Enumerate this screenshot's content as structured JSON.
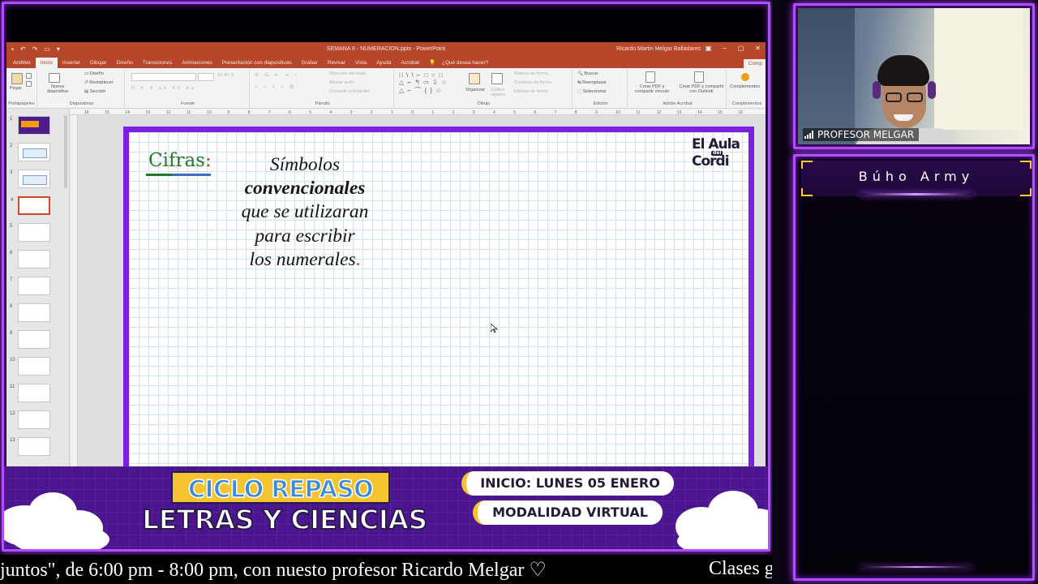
{
  "powerpoint": {
    "document_title": "SEMANA 8 - NUMERACION.pptx - PowerPoint",
    "user_name": "Ricardo Martin Melgar Balladares",
    "tabs": [
      "Archivo",
      "Inicio",
      "Insertar",
      "Dibujar",
      "Diseño",
      "Transiciones",
      "Animaciones",
      "Presentación con diapositivas",
      "Grabar",
      "Revisar",
      "Vista",
      "Ayuda",
      "Acrobat"
    ],
    "active_tab": "Inicio",
    "tell_me": "¿Qué desea hacer?",
    "share_label": "Comp",
    "ribbon": {
      "portapapeles": "Portapapeles",
      "pegar": "Pegar",
      "diapositivas": "Diapositivas",
      "nueva_diapositiva": "Nueva diapositiva",
      "diseno": "Diseño",
      "restablecer": "Restablecer",
      "seccion": "Sección",
      "fuente": "Fuente",
      "parrafo": "Párrafo",
      "direccion_texto": "Dirección del texto",
      "alinear_texto": "Alinear texto",
      "convertir_smartart": "Convertir a SmartArt",
      "dibujo": "Dibujo",
      "organizar": "Organizar",
      "estilos_rapidos": "Estilos rápidos",
      "relleno_forma": "Relleno de forma",
      "contorno_forma": "Contorno de forma",
      "efectos_forma": "Efectos de forma",
      "edicion": "Edición",
      "buscar": "Buscar",
      "reemplazar": "Reemplazar",
      "seleccionar": "Seleccionar",
      "adobe_acrobat": "Adobe Acrobat",
      "crear_pdf_vinculo": "Crear PDF y compartir vínculo",
      "crear_pdf_outlook": "Crear PDF y compartir con Outlook",
      "complementos": "Complementos"
    },
    "ruler_ticks": [
      "16",
      "15",
      "14",
      "13",
      "12",
      "11",
      "10",
      "9",
      "8",
      "7",
      "6",
      "5",
      "4",
      "3",
      "2",
      "1",
      "0",
      "1",
      "2",
      "3",
      "4",
      "5",
      "6",
      "7",
      "8",
      "9",
      "10",
      "11",
      "12",
      "13",
      "14",
      "15",
      "16"
    ],
    "thumbnails": [
      "1",
      "2",
      "3",
      "4",
      "5",
      "6",
      "7",
      "8",
      "9",
      "10",
      "11",
      "12",
      "13"
    ],
    "selected_slide": "4"
  },
  "slide": {
    "heading": "Cifras",
    "heading_colon": ":",
    "body_lines": [
      "Símbolos",
      "convencionales",
      "que se utilizaran",
      "para escribir",
      "los numerales"
    ],
    "body_period": ".",
    "logo_line1": "El Aula",
    "logo_del": "del",
    "logo_line2": "Cordi"
  },
  "banner": {
    "ciclo": "CICLO REPASO",
    "letras": "LETRAS Y CIENCIAS",
    "inicio": "INICIO: LUNES 05 ENERO",
    "modalidad": "MODALIDAD VIRTUAL"
  },
  "ticker": {
    "text": "juntos\", de 6:00 pm - 8:00 pm, con nuesto profesor Ricardo Melgar ♡",
    "text2": "Clases g"
  },
  "webcam": {
    "name": "PROFESOR MELGAR"
  },
  "chat": {
    "title": "Búho Army"
  },
  "colors": {
    "frame": "#b44cff",
    "ppt_accent": "#b7472a",
    "slide_border": "#7b1fe0",
    "banner_bg": "#4b1590",
    "ciclo_bg": "#f6c431"
  }
}
